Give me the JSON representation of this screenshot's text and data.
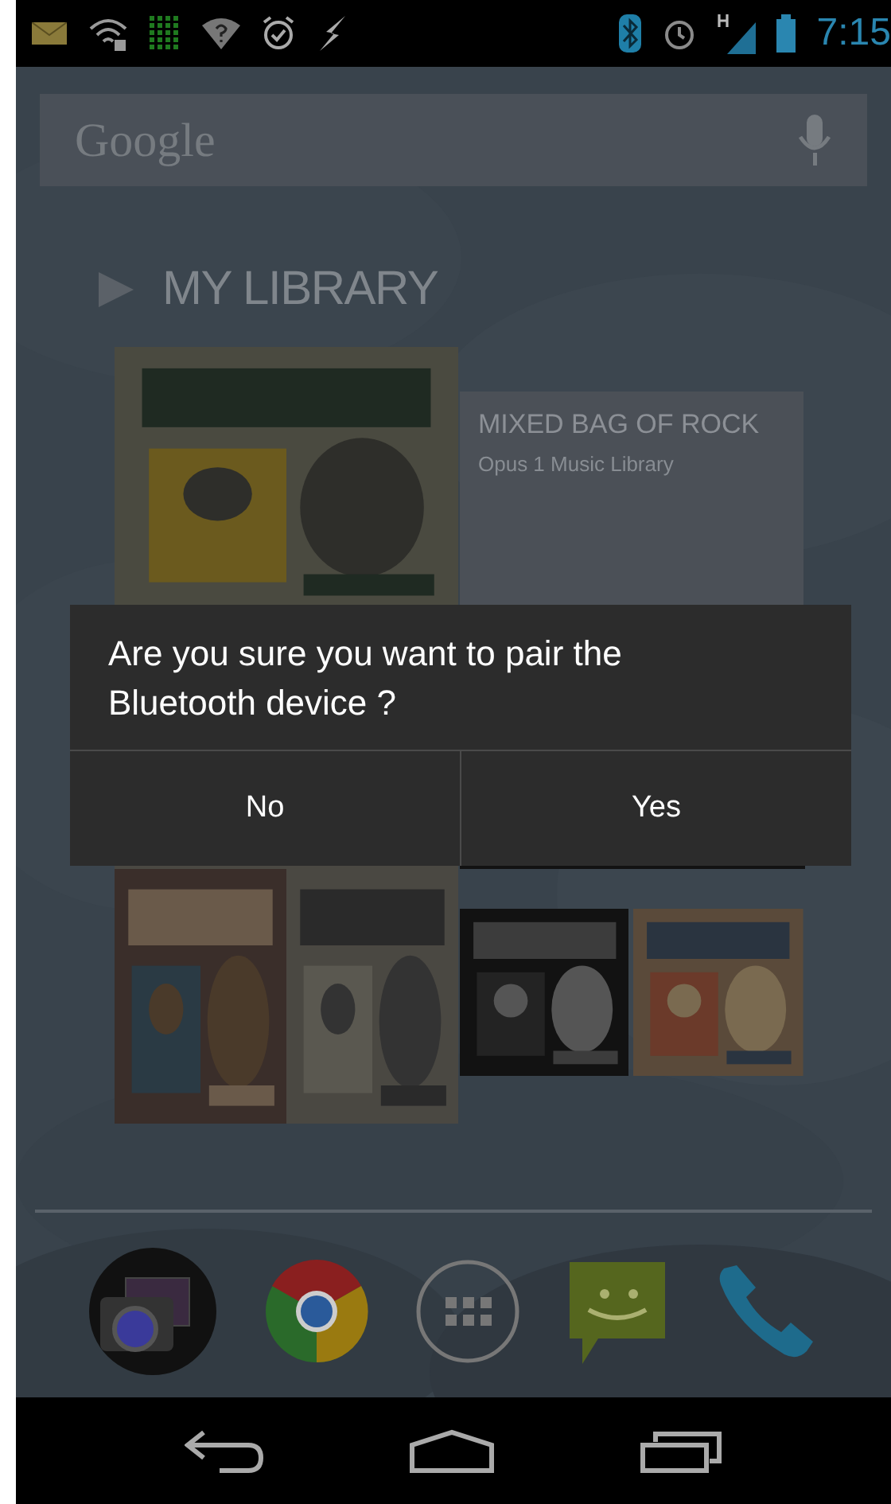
{
  "status_bar": {
    "time": "7:15"
  },
  "search": {
    "placeholder": "Google"
  },
  "library": {
    "title": "MY LIBRARY",
    "album": {
      "title": "MIXED BAG OF ROCK",
      "subtitle": "Opus 1 Music Library"
    }
  },
  "dialog": {
    "message": "Are you sure you want to pair the Bluetooth device ?",
    "buttons": [
      "No",
      "Yes"
    ]
  }
}
